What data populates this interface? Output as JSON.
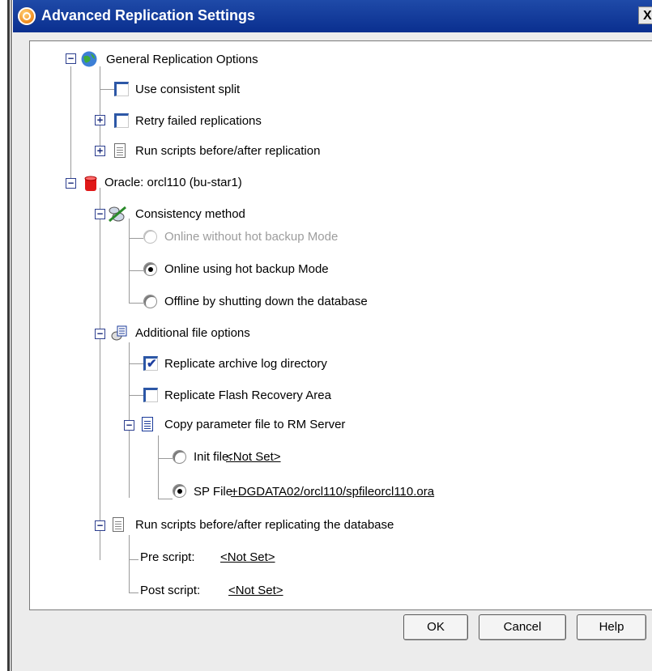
{
  "window": {
    "title": "Advanced Replication Settings",
    "close_label": "X"
  },
  "tree": {
    "general": {
      "label": "General Replication Options",
      "use_consistent_split": {
        "label": "Use consistent split",
        "checked": false
      },
      "retry_failed": {
        "label": "Retry failed replications",
        "checked": false
      },
      "run_scripts": {
        "label": "Run scripts before/after replication"
      }
    },
    "oracle": {
      "label": "Oracle:  orcl110 (bu-star1)",
      "consistency": {
        "label": "Consistency method",
        "options": [
          {
            "label": "Online without hot backup Mode",
            "selected": false,
            "enabled": false
          },
          {
            "label": "Online using hot backup Mode",
            "selected": true,
            "enabled": true
          },
          {
            "label": "Offline by shutting down the database",
            "selected": false,
            "enabled": true
          }
        ]
      },
      "additional": {
        "label": "Additional file options",
        "replicate_archive": {
          "label": "Replicate archive log directory",
          "checked": true
        },
        "replicate_flash": {
          "label": "Replicate Flash Recovery Area",
          "checked": false
        },
        "copy_param": {
          "label": "Copy parameter file to RM Server",
          "init_file": {
            "label": "Init file:",
            "value": "<Not Set>",
            "selected": false
          },
          "sp_file": {
            "label": "SP File:",
            "value": "+DGDATA02/orcl110/spfileorcl110.ora",
            "selected": true
          }
        }
      },
      "run_scripts_db": {
        "label": "Run scripts before/after replicating the database",
        "pre_script": {
          "label": "Pre script:",
          "value": "<Not Set>"
        },
        "post_script": {
          "label": "Post script:",
          "value": "<Not Set>"
        }
      }
    }
  },
  "buttons": {
    "ok": "OK",
    "cancel": "Cancel",
    "help": "Help"
  },
  "colors": {
    "titlebar": "#0a2f8f",
    "dialog_bg": "#ececec",
    "checkbox_accent": "#2c57a6"
  }
}
